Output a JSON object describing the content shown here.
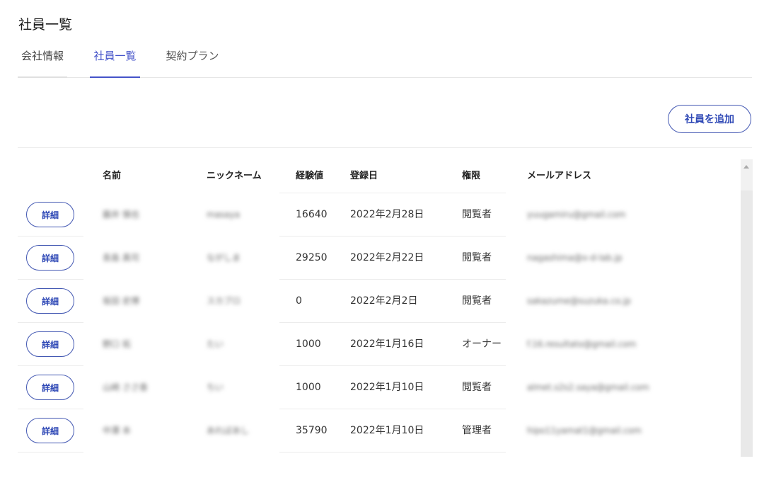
{
  "page": {
    "title": "社員一覧"
  },
  "tabs": [
    {
      "label": "会社情報"
    },
    {
      "label": "社員一覧"
    },
    {
      "label": "契約プラン"
    }
  ],
  "toolbar": {
    "add_label": "社員を追加"
  },
  "table": {
    "columns": [
      "",
      "名前",
      "ニックネーム",
      "経験値",
      "登録日",
      "権限",
      "メールアドレス"
    ],
    "rows": [
      {
        "detail": "詳細",
        "name": "藤井 慎也",
        "nickname": "masaya",
        "exp": "16640",
        "date": "2022年2月28日",
        "role": "閲覧者",
        "email": "yuugamiru@gmail.com"
      },
      {
        "detail": "詳細",
        "name": "長島 真司",
        "nickname": "ながしま",
        "exp": "29250",
        "date": "2022年2月22日",
        "role": "閲覧者",
        "email": "nagashima@x-d-lab.jp"
      },
      {
        "detail": "詳細",
        "name": "坂田 史博",
        "nickname": "スカブロ",
        "exp": "0",
        "date": "2022年2月2日",
        "role": "閲覧者",
        "email": "sakazume@suzuka.co.jp"
      },
      {
        "detail": "詳細",
        "name": "野口 拓",
        "nickname": "たい",
        "exp": "1000",
        "date": "2022年1月16日",
        "role": "オーナー",
        "email": "f.16.resultato@gmail.com"
      },
      {
        "detail": "詳細",
        "name": "山崎 ささ香",
        "nickname": "ちい",
        "exp": "1000",
        "date": "2022年1月10日",
        "role": "閲覧者",
        "email": "almet.s2s2.saya@gmail.com"
      },
      {
        "detail": "詳細",
        "name": "中澤 本",
        "nickname": "あればあし",
        "exp": "35790",
        "date": "2022年1月10日",
        "role": "管理者",
        "email": "hipo11yamat1@gmail.com"
      }
    ]
  }
}
